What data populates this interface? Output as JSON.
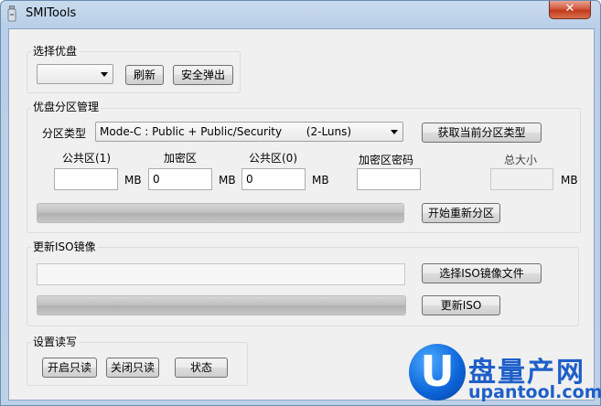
{
  "window": {
    "title": "SMITools",
    "close_label": "✕"
  },
  "select_disk": {
    "title": "选择优盘",
    "disk_value": "",
    "refresh_label": "刷新",
    "eject_label": "安全弹出"
  },
  "partition": {
    "title": "优盘分区管理",
    "type_label": "分区类型",
    "type_value": "Mode-C : Public + Public/Security       (2-Luns)",
    "get_type_label": "获取当前分区类型",
    "public1_label": "公共区(1)",
    "public1_value": "",
    "mb1": "MB",
    "encrypted_label": "加密区",
    "encrypted_value": "0",
    "mb2": "MB",
    "public0_label": "公共区(0)",
    "public0_value": "0",
    "mb3": "MB",
    "password_label": "加密区密码",
    "password_value": "",
    "total_label": "总大小",
    "total_value": "",
    "mb4": "MB",
    "progress": 1.0,
    "start_label": "开始重新分区"
  },
  "iso": {
    "title": "更新ISO镜像",
    "file_path": "",
    "choose_label": "选择ISO镜像文件",
    "progress": 1.0,
    "update_label": "更新ISO"
  },
  "rw": {
    "title": "设置读写",
    "enable_ro_label": "开启只读",
    "disable_ro_label": "关闭只读",
    "status_label": "状态"
  },
  "watermark": {
    "title": "盘量产网",
    "url": "upantool.com",
    "badge": "U"
  },
  "colors": {
    "close": "#c23a1c",
    "brand": "#1e5fc9"
  }
}
